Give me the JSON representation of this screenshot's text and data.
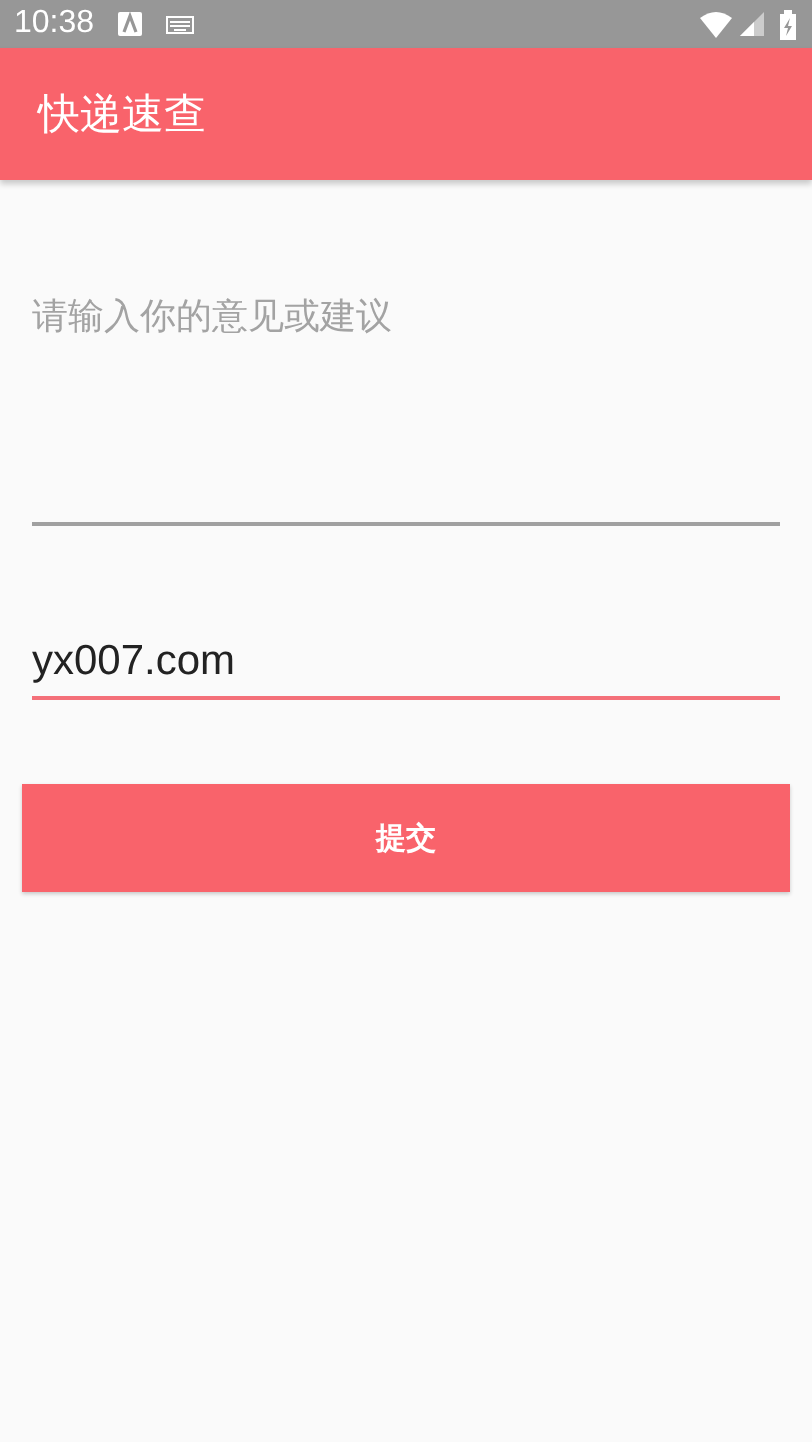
{
  "status_bar": {
    "time": "10:38"
  },
  "app_bar": {
    "title": "快递速查"
  },
  "fields": [
    {
      "kind": "multiline",
      "placeholder": "请输入你的意见或建议",
      "focused": false
    },
    {
      "kind": "single",
      "value": "yx007.com",
      "focused": true
    }
  ],
  "submit_button": {
    "label": "提交"
  }
}
